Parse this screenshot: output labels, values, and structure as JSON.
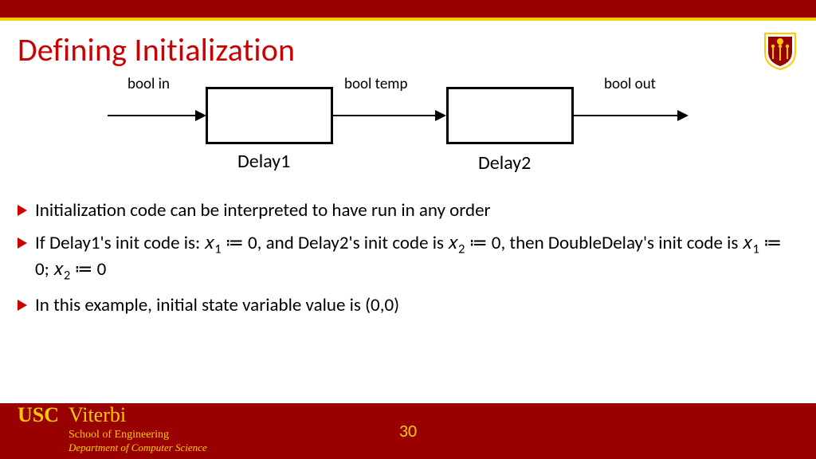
{
  "title": "Defining Initialization",
  "diagram": {
    "signals": {
      "in": "bool in",
      "mid": "bool temp",
      "out": "bool out"
    },
    "blocks": {
      "b1": "Delay1",
      "b2": "Delay2"
    }
  },
  "bullets": [
    "Initialization code can be interpreted to have run in any order",
    "If Delay1's init code is: 𝑥<sub class=\"sub\">1</sub> ≔ 0, and Delay2's init code is 𝑥<sub class=\"sub\">2</sub> ≔ 0, then DoubleDelay's init code is 𝑥<sub class=\"sub\">1</sub> ≔ 0; 𝑥<sub class=\"sub\">2</sub> ≔ 0",
    "In this example, initial state variable value is (0,0)"
  ],
  "footer": {
    "usc": "USC",
    "viterbi": "Viterbi",
    "soe": "School of Engineering",
    "dept": "Department of Computer Science",
    "page": "30"
  }
}
